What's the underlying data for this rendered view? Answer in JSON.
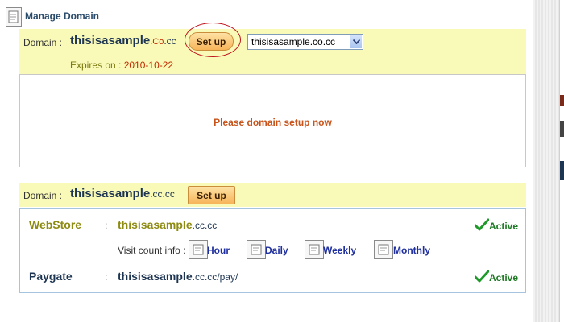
{
  "header": {
    "title": "Manage Domain",
    "icon": "document-icon"
  },
  "domain1": {
    "label": "Domain :",
    "name_main": "thisisasample",
    "name_ext_red": ".Co",
    "name_ext": ".cc",
    "setup_label": "Set up",
    "select_value": "thisisasample.co.cc",
    "expires_label": "Expires on :",
    "expires_date": "2010-10-22",
    "setup_message": "Please domain setup now"
  },
  "domain2": {
    "label": "Domain :",
    "name_main": "thisisasample",
    "name_ext": ".cc.cc",
    "setup_label": "Set up",
    "webstore": {
      "label": "WebStore",
      "sep": ":",
      "url_main": "thisisasample",
      "url_ext": ".cc.cc",
      "status": "Active"
    },
    "visit": {
      "label": "Visit count info :",
      "items": [
        "Hour",
        "Daily",
        "Weekly",
        "Monthly"
      ]
    },
    "paygate": {
      "label": "Paygate",
      "sep": ":",
      "url_main": "thisisasample",
      "url_ext": ".cc.cc/pay/",
      "status": "Active"
    }
  },
  "colors": {
    "accent_band": "#fafab8",
    "button": "#f7b55a",
    "active": "#1e7a24",
    "message": "#c8541b"
  }
}
